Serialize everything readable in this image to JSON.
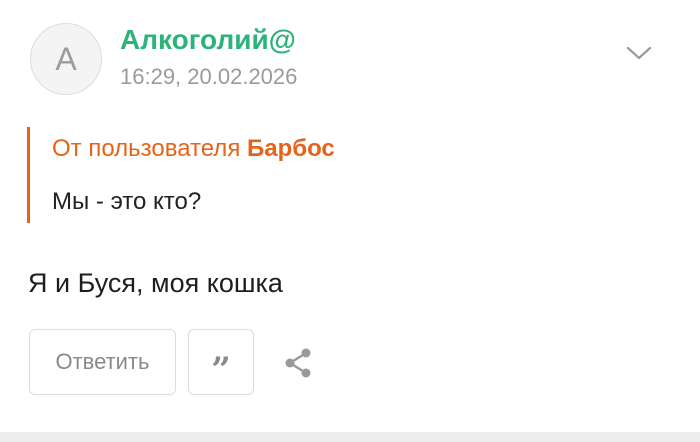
{
  "comment": {
    "avatar_letter": "A",
    "author": "Алкоголий@",
    "timestamp": "16:29, 20.02.2026",
    "quote": {
      "prefix": "От пользователя ",
      "author": "Барбос",
      "text": "Мы - это кто?"
    },
    "text": "Я и Буся, моя кошка"
  },
  "actions": {
    "reply_label": "Ответить",
    "quote_glyph": "”",
    "quote_icon": "quote-icon",
    "share_icon": "share-icon",
    "menu_icon": "chevron-down-icon"
  },
  "colors": {
    "author": "#2db37a",
    "quote_accent": "#e8631a",
    "muted": "#9a9a9a",
    "border": "#dcdcdc"
  }
}
